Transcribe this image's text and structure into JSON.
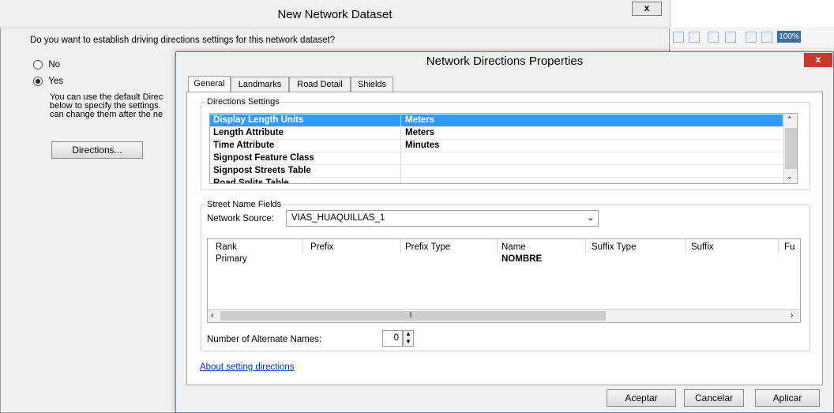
{
  "background_window": {
    "title": "New Network Dataset",
    "close_label": "x",
    "question": "Do you want to establish driving directions settings for this network dataset?",
    "option_no": "No",
    "option_yes": "Yes",
    "desc_line1": "You can use the default Direc",
    "desc_line2": "below to specify the settings.",
    "desc_line3": "can change them after the ne",
    "directions_button": "Directions..."
  },
  "right_strip": {
    "zoom_label": "100%"
  },
  "dialog": {
    "title": "Network Directions Properties",
    "close_label": "x",
    "tabs": [
      "General",
      "Landmarks",
      "Road Detail",
      "Shields"
    ],
    "active_tab": "General",
    "directions_settings": {
      "label": "Directions Settings",
      "rows": [
        {
          "key": "Display Length Units",
          "value": "Meters",
          "selected": true
        },
        {
          "key": "Length Attribute",
          "value": "Meters"
        },
        {
          "key": "Time Attribute",
          "value": "Minutes"
        },
        {
          "key": "Signpost Feature Class",
          "value": ""
        },
        {
          "key": "Signpost Streets Table",
          "value": ""
        },
        {
          "key": "Road Splits Table",
          "value": ""
        }
      ]
    },
    "street_name_fields": {
      "label": "Street Name Fields",
      "network_source_label": "Network Source:",
      "network_source_value": "VIAS_HUAQUILLAS_1",
      "columns": [
        "Rank",
        "Prefix",
        "Prefix Type",
        "Name",
        "Suffix Type",
        "Suffix",
        "Fu"
      ],
      "rows": [
        {
          "rank": "Primary",
          "prefix": "",
          "prefix_type": "",
          "name": "NOMBRE",
          "suffix_type": "",
          "suffix": ""
        }
      ],
      "alt_names_label": "Number of Alternate Names:",
      "alt_names_value": "0"
    },
    "about_link": "About setting directions",
    "buttons": {
      "ok": "Aceptar",
      "cancel": "Cancelar",
      "apply": "Aplicar"
    }
  }
}
